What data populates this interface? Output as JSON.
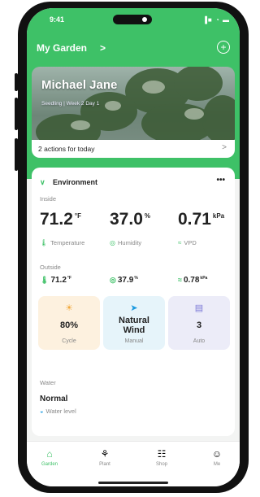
{
  "status_bar": {
    "time": "9:41",
    "icons": "▐■ ◔ ▬"
  },
  "header": {
    "title": "My Garden",
    "chevron": ">",
    "add_icon": "+"
  },
  "hero": {
    "name": "Michael Jane",
    "subtitle": "Seedling | Week 2 Day 1"
  },
  "actions": {
    "label": "2 actions for today",
    "arrow": ">"
  },
  "environment": {
    "heading": "Environment",
    "more": "•••",
    "logo": "∨",
    "inside": {
      "label": "Inside",
      "temperature": {
        "value": "71.2",
        "unit": "°F",
        "label": "Temperature",
        "icon": "🌡"
      },
      "humidity": {
        "value": "37.0",
        "unit": "%",
        "label": "Humidity",
        "icon": "◎"
      },
      "vpd": {
        "value": "0.71",
        "unit": "kPa",
        "label": "VPD",
        "icon": "≈"
      }
    },
    "outside": {
      "label": "Outside",
      "temperature": {
        "value": "71.2",
        "unit": "°F",
        "icon": "🌡"
      },
      "humidity": {
        "value": "37.9",
        "unit": "%",
        "icon": "◎"
      },
      "vpd": {
        "value": "0.78",
        "unit": "kPa",
        "icon": "≈"
      }
    },
    "tiles": [
      {
        "icon": "☀",
        "value": "80%",
        "caption": "Cycle",
        "color": "#fdf1df"
      },
      {
        "icon": "➤",
        "value_line1": "Natural",
        "value_line2": "Wind",
        "caption": "Manual",
        "color": "#e6f4fa"
      },
      {
        "icon": "▤",
        "value": "3",
        "caption": "Auto",
        "color": "#ececf8"
      }
    ],
    "water": {
      "label": "Water",
      "value": "Normal",
      "sub": "Water level",
      "icon": "◒"
    }
  },
  "tabs": [
    {
      "label": "Garden",
      "icon": "⌂",
      "active": true
    },
    {
      "label": "Plant",
      "icon": "⚘",
      "active": false
    },
    {
      "label": "Shop",
      "icon": "☷",
      "active": false
    },
    {
      "label": "Me",
      "icon": "☺",
      "active": false
    }
  ],
  "colors": {
    "brand_green": "#3ec167",
    "accent_blue": "#1e9be0"
  }
}
